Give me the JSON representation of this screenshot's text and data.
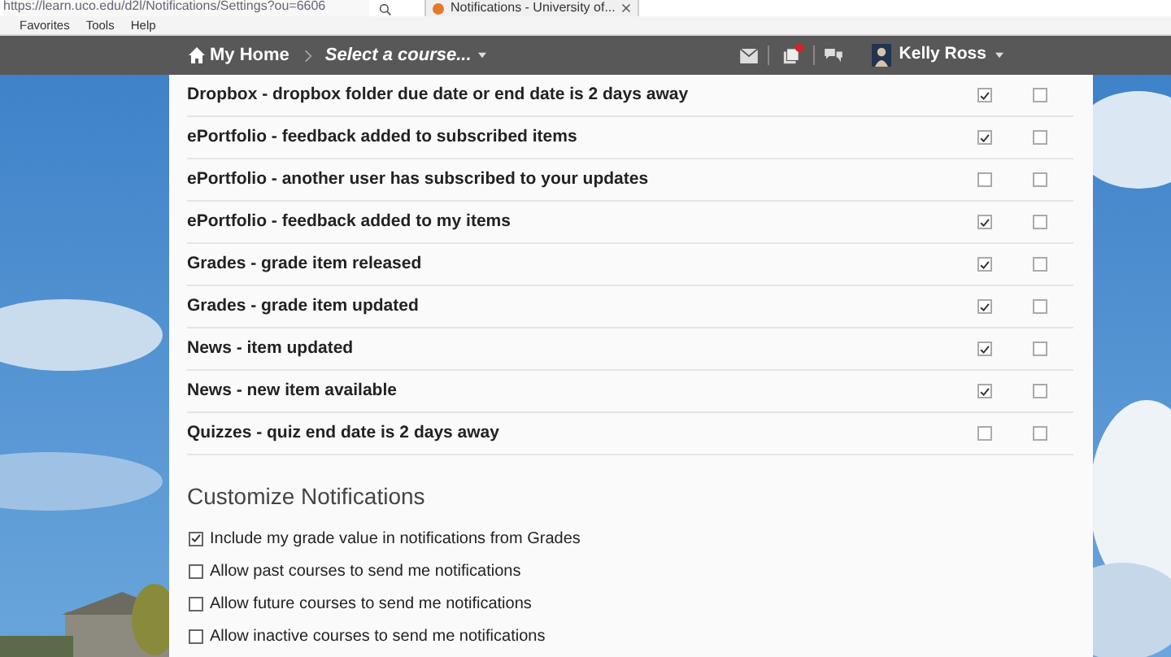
{
  "browser": {
    "address": "https://learn.uco.edu/d2l/Notifications/Settings?ou=6606",
    "tab_title": "Notifications - University of...",
    "menu": [
      "Favorites",
      "Tools",
      "Help"
    ]
  },
  "nav": {
    "home": "My Home",
    "course_selector": "Select a course...",
    "alert_badge": true,
    "user_name": "Kelly Ross"
  },
  "notifications": [
    {
      "label": "Dropbox - dropbox folder due date or end date is 2 days away",
      "checks": [
        true,
        false
      ]
    },
    {
      "label": "ePortfolio - feedback added to subscribed items",
      "checks": [
        true,
        false
      ]
    },
    {
      "label": "ePortfolio - another user has subscribed to your updates",
      "checks": [
        false,
        false
      ]
    },
    {
      "label": "ePortfolio - feedback added to my items",
      "checks": [
        true,
        false
      ]
    },
    {
      "label": "Grades - grade item released",
      "checks": [
        true,
        false
      ]
    },
    {
      "label": "Grades - grade item updated",
      "checks": [
        true,
        false
      ]
    },
    {
      "label": "News - item updated",
      "checks": [
        true,
        false
      ]
    },
    {
      "label": "News - new item available",
      "checks": [
        true,
        false
      ]
    },
    {
      "label": "Quizzes - quiz end date is 2 days away",
      "checks": [
        false,
        false
      ]
    }
  ],
  "customize": {
    "title": "Customize Notifications",
    "options": [
      {
        "label": "Include my grade value in notifications from Grades",
        "checked": true
      },
      {
        "label": "Allow past courses to send me notifications",
        "checked": false
      },
      {
        "label": "Allow future courses to send me notifications",
        "checked": false
      },
      {
        "label": "Allow inactive courses to send me notifications",
        "checked": false
      }
    ]
  }
}
